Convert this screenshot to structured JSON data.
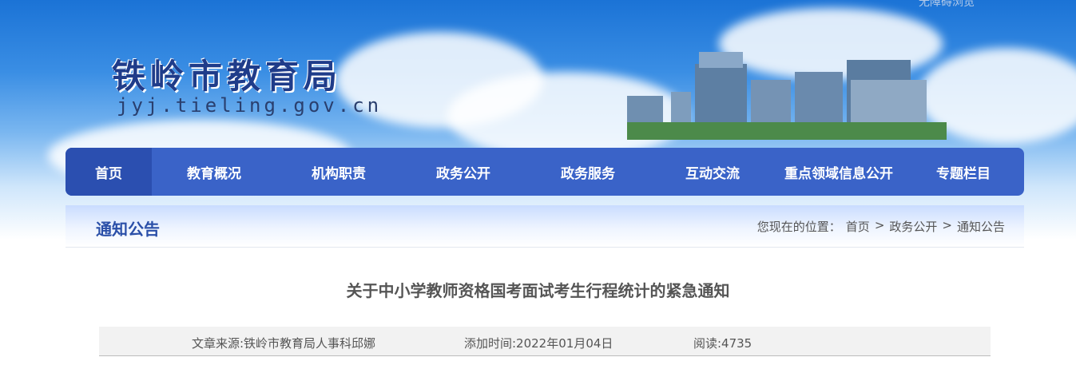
{
  "site": {
    "name_cn": "铁岭市教育局",
    "domain": "jyj.tieling.gov.cn",
    "top_link": "无障碍浏览"
  },
  "nav": {
    "items": [
      {
        "label": "首页",
        "active": true
      },
      {
        "label": "教育概况"
      },
      {
        "label": "机构职责"
      },
      {
        "label": "政务公开"
      },
      {
        "label": "政务服务"
      },
      {
        "label": "互动交流"
      },
      {
        "label": "重点领域信息公开"
      },
      {
        "label": "专题栏目"
      }
    ]
  },
  "section": {
    "title": "通知公告",
    "breadcrumb_prefix": "您现在的位置：",
    "crumbs": [
      "首页",
      "政务公开",
      "通知公告"
    ],
    "separator": ">"
  },
  "article": {
    "title": "关于中小学教师资格国考面试考生行程统计的紧急通知",
    "source": "文章来源:铁岭市教育局人事科邱娜",
    "date": "添加时间:2022年01月04日",
    "views": "阅读:4735"
  },
  "colors": {
    "nav_bg": "#3a63c8",
    "nav_active": "#2b4fb0",
    "section_title": "#2a4fa8"
  }
}
